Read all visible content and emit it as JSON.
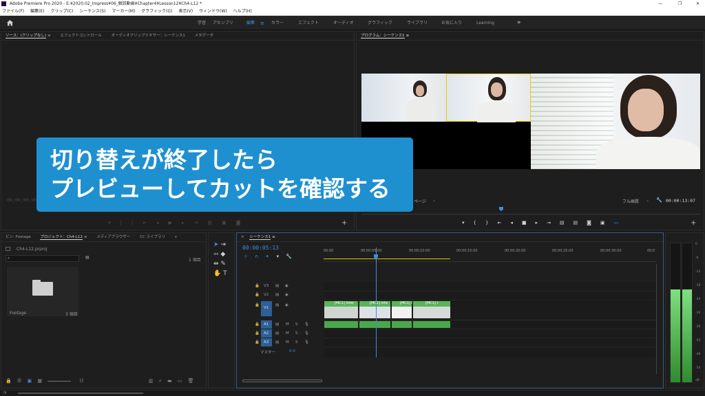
{
  "window": {
    "title": "Adobe Premiere Pro 2020 - E:¥2020.02_Impress¥06_解説動画¥Chapter4¥Lesson12¥Ch4-L12 *",
    "min": "—",
    "max": "❐",
    "close": "✕"
  },
  "menu": [
    "ファイル(F)",
    "編集(E)",
    "クリップ(C)",
    "シーケンス(S)",
    "マーカー(M)",
    "グラフィック(G)",
    "表示(V)",
    "ウィンドウ(W)",
    "ヘルプ(H)"
  ],
  "workspaces": [
    "学習",
    "アセンブリ",
    "編集",
    "カラー",
    "エフェクト",
    "オーディオ",
    "グラフィック",
    "ライブラリ",
    "お気に入り",
    "Learning"
  ],
  "workspaces_more": "»",
  "source_panel": {
    "tabs": [
      "ソース：(クリップなし)",
      "エフェクトコントロール",
      "オーディオクリップミキサー：シーケンス1",
      "メタデータ"
    ],
    "timecode": "00;00;00;00"
  },
  "program_panel": {
    "tab": "プログラム：シーケンス1",
    "zoom": "ページ",
    "quality": "フル画質",
    "duration": "00:00:13:07"
  },
  "caption": {
    "line1": "切り替えが終了したら",
    "line2": "プレビューしてカットを確認する"
  },
  "project_panel": {
    "tabs": [
      "ビン: Footage",
      "プロジェクト：Ch4-L12",
      "メディアブラウザー",
      "CC ライブラリ"
    ],
    "project_file": "Ch4-L12.prproj",
    "item_count": "1 項目",
    "bin_name": "Footage",
    "bin_count": "3 項目",
    "search_placeholder": ""
  },
  "timeline": {
    "tab": "シーケンス1",
    "timecode": "00:00:05:13",
    "ruler": [
      "00:00",
      "00:00:05:00",
      "00:00:10:00",
      "00:00:15:00",
      "00:00:20:00",
      "00:00:25:00",
      "00:00:30:00",
      "00:0"
    ],
    "video_tracks": [
      "V3",
      "V2",
      "V1"
    ],
    "audio_tracks": [
      "A1",
      "A2",
      "A3"
    ],
    "master": {
      "label": "マスター",
      "value": "0.0"
    },
    "clips": [
      "[MC1] Inter",
      "[MC2] Inte",
      "[MC1] I",
      "[MC1] I"
    ]
  },
  "audio_meter": {
    "labels": [
      "0",
      "-6",
      "-12",
      "-18",
      "-24",
      "-30",
      "-36",
      "-42",
      "-48",
      "-54",
      "dB"
    ],
    "level": 0.67
  }
}
